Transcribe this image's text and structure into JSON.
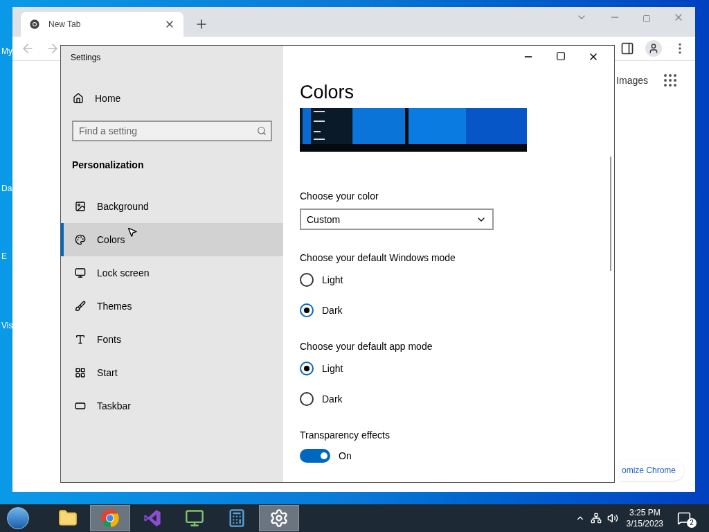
{
  "desktop": {
    "icon_labels": [
      "My",
      "Da",
      "E",
      "Vis"
    ]
  },
  "browser": {
    "tabs": [
      {
        "label": "New Tab",
        "selected": true
      }
    ],
    "images_link": "Images",
    "customize_button": "omize Chrome"
  },
  "settings": {
    "title": "Settings",
    "home": "Home",
    "search": {
      "placeholder": "Find a setting"
    },
    "section": "Personalization",
    "nav": [
      {
        "kind": "background",
        "label": "Background",
        "selected": false
      },
      {
        "kind": "colors",
        "label": "Colors",
        "selected": true
      },
      {
        "kind": "lock",
        "label": "Lock screen",
        "selected": false
      },
      {
        "kind": "themes",
        "label": "Themes",
        "selected": false
      },
      {
        "kind": "fonts",
        "label": "Fonts",
        "selected": false
      },
      {
        "kind": "start",
        "label": "Start",
        "selected": false
      },
      {
        "kind": "taskbar",
        "label": "Taskbar",
        "selected": false
      }
    ],
    "page_title": "Colors",
    "color_choice": {
      "label": "Choose your color",
      "value": "Custom"
    },
    "windows_mode": {
      "label": "Choose your default Windows mode",
      "options": [
        {
          "label": "Light",
          "selected": false
        },
        {
          "label": "Dark",
          "selected": true
        }
      ]
    },
    "app_mode": {
      "label": "Choose your default app mode",
      "options": [
        {
          "label": "Light",
          "selected": true
        },
        {
          "label": "Dark",
          "selected": false
        }
      ]
    },
    "transparency": {
      "label": "Transparency effects",
      "on": true,
      "state_text": "On"
    }
  },
  "taskbar": {
    "apps": [
      {
        "kind": "explorer",
        "active": false
      },
      {
        "kind": "chrome",
        "active": true
      },
      {
        "kind": "studio",
        "active": false
      },
      {
        "kind": "monitor",
        "active": false
      },
      {
        "kind": "calculator",
        "active": false
      },
      {
        "kind": "settings",
        "active": true
      }
    ],
    "time": "3:25 PM",
    "date": "3/15/2023",
    "notification_count": "2"
  }
}
